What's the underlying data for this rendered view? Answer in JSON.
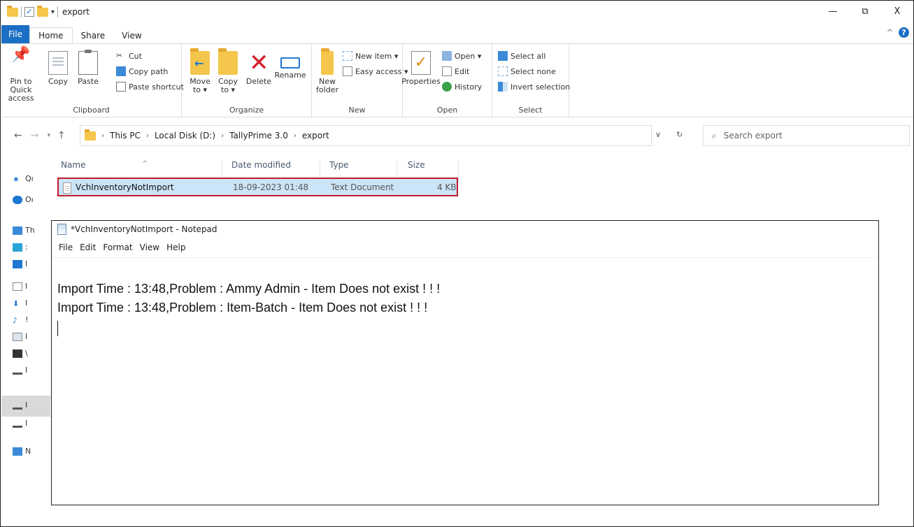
{
  "window": {
    "title": "export",
    "controls": {
      "minimize": "—",
      "maximize": "⧉",
      "close": "X"
    }
  },
  "ribbon_tabs": [
    "File",
    "Home",
    "Share",
    "View"
  ],
  "ribbon": {
    "clipboard": {
      "label": "Clipboard",
      "pin_to_quick_access": "Pin to Quick access",
      "copy": "Copy",
      "paste": "Paste",
      "cut": "Cut",
      "copy_path": "Copy path",
      "paste_shortcut": "Paste shortcut"
    },
    "organize": {
      "label": "Organize",
      "move_to": "Move to ▾",
      "copy_to": "Copy to ▾",
      "delete": "Delete",
      "rename": "Rename"
    },
    "new": {
      "label": "New",
      "new_folder": "New folder",
      "new_item": "New item ▾",
      "easy_access": "Easy access ▾"
    },
    "open": {
      "label": "Open",
      "properties": "Properties",
      "open": "Open ▾",
      "edit": "Edit",
      "history": "History"
    },
    "select": {
      "label": "Select",
      "select_all": "Select all",
      "select_none": "Select none",
      "invert_selection": "Invert selection"
    }
  },
  "address": {
    "crumbs": [
      "This PC",
      "Local Disk (D:)",
      "TallyPrime 3.0",
      "export"
    ],
    "search_placeholder": "Search export"
  },
  "file_list": {
    "columns": [
      "Name",
      "Date modified",
      "Type",
      "Size"
    ],
    "rows": [
      {
        "name": "VchInventoryNotImport",
        "date": "18-09-2023 01:48",
        "type": "Text Document",
        "size": "4 KB"
      }
    ]
  },
  "nav_pane": [
    "Qı",
    "Oı",
    "Th",
    ":",
    "I",
    "I",
    "I",
    "!",
    "I",
    "\\",
    "I",
    "I",
    "I",
    "N"
  ],
  "notepad": {
    "title": "*VchInventoryNotImport - Notepad",
    "menu": [
      "File",
      "Edit",
      "Format",
      "View",
      "Help"
    ],
    "lines": [
      "Import Time : 13:48,Problem : Ammy Admin - Item Does not exist ! ! !",
      "Import Time : 13:48,Problem : Item-Batch - Item Does not exist ! ! !"
    ]
  }
}
